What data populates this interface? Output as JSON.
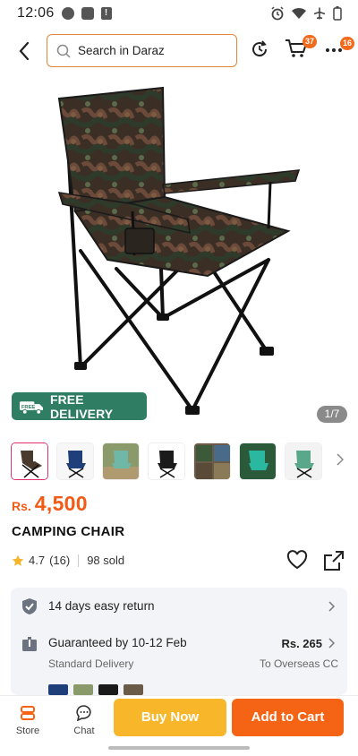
{
  "status_bar": {
    "time": "12:06"
  },
  "header": {
    "search_placeholder": "Search in Daraz",
    "cart_count": "37",
    "more_count": "16"
  },
  "product": {
    "delivery_badge": "FREE DELIVERY",
    "delivery_badge_icon_text": "FREE",
    "image_counter": "1/7",
    "price_currency": "Rs.",
    "price_value": "4,500",
    "title": "CAMPING CHAIR",
    "rating": "4.7",
    "rating_count": "(16)",
    "sold": "98 sold"
  },
  "info": {
    "return_label": "14 days easy return",
    "guarantee_label": "Guaranteed by 10-12 Feb",
    "delivery_type": "Standard Delivery",
    "delivery_fee": "Rs. 265",
    "destination": "To Overseas CC"
  },
  "bottom_bar": {
    "store_label": "Store",
    "chat_label": "Chat",
    "buy_now_label": "Buy Now",
    "add_to_cart_label": "Add to Cart"
  },
  "colors": {
    "brand_orange": "#f56415",
    "buy_yellow": "#f8b62b",
    "price_orange": "#f25a15",
    "delivery_green": "#2f7d63",
    "search_border": "#e2863c"
  }
}
